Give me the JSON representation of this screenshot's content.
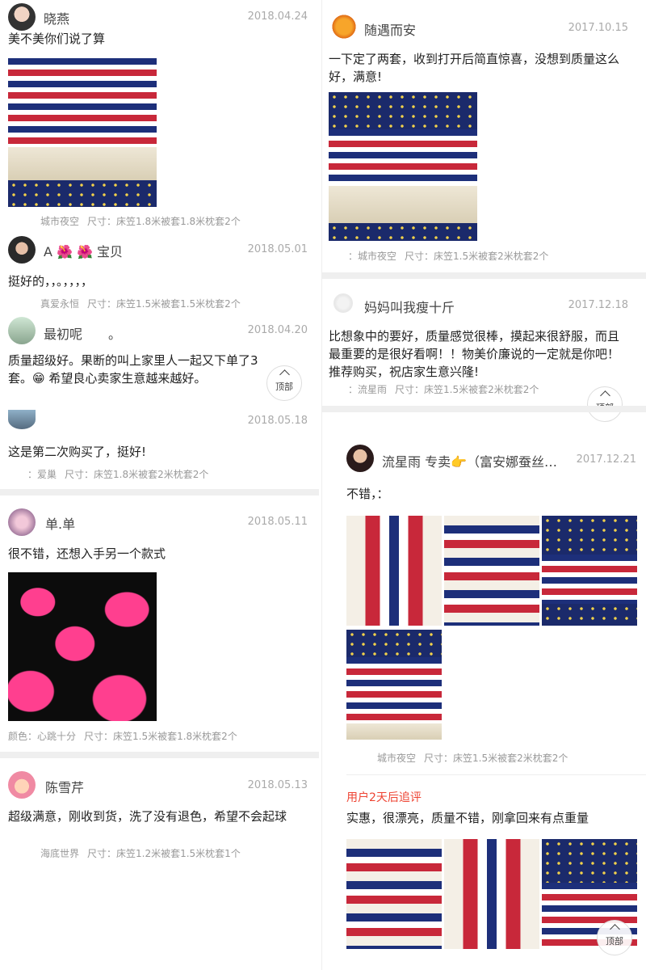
{
  "left_reviews": [
    {
      "user": "晓燕",
      "date": "2018.04.24",
      "text": "美不美你们说了算",
      "meta_a": "城市夜空",
      "meta_b": "尺寸：床笠1.8米被套1.8米枕套2个"
    },
    {
      "user": "A 🌺 🌺 宝贝",
      "date": "2018.05.01",
      "text": "挺好的，，。，，，，",
      "meta_a": "真爱永恒",
      "meta_b": "尺寸：床笠1.5米被套1.5米枕套2个"
    },
    {
      "user": "最初呢　　。",
      "date": "2018.04.20",
      "text": "质量超级好。果断的叫上家里人一起又下单了3套。😁 希望良心卖家生意越来越好。"
    },
    {
      "user": "",
      "date": "2018.05.18",
      "text": "这是第二次购买了，挺好!",
      "meta_a": "：爱巢",
      "meta_b": "尺寸：床笠1.8米被套2米枕套2个"
    },
    {
      "user": "单.单",
      "date": "2018.05.11",
      "text": "很不错，还想入手另一个款式",
      "meta_a": "颜色：心跳十分",
      "meta_b": "尺寸：床笠1.5米被套1.8米枕套2个"
    },
    {
      "user": "陈雪芹",
      "date": "2018.05.13",
      "text": "超级满意，刚收到货，洗了没有退色，希望不会起球",
      "meta_a": "海底世界",
      "meta_b": "尺寸：床笠1.2米被套1.5米枕套1个"
    }
  ],
  "right_reviews": [
    {
      "user": "随遇而安",
      "date": "2017.10.15",
      "text": "一下定了两套，收到打开后简直惊喜，没想到质量这么好，满意!",
      "meta_a": "：城市夜空",
      "meta_b": "尺寸：床笠1.5米被套2米枕套2个"
    },
    {
      "user": "妈妈叫我瘦十斤",
      "date": "2017.12.18",
      "text": "比想象中的要好，质量感觉很棒，摸起来很舒服，而且最重要的是很好看啊！！物美价廉说的一定就是你吧！推荐购买，祝店家生意兴隆!",
      "meta_a": "：流星雨",
      "meta_b": "尺寸：床笠1.5米被套2米枕套2个"
    },
    {
      "user": "流星雨 专卖👉（富安娜蚕丝…",
      "date": "2017.12.21",
      "text": "不错，：",
      "meta_a": "城市夜空",
      "meta_b": "尺寸：床笠1.5米被套2米枕套2个",
      "follow_label": "用户2天后追评",
      "follow_text": "实惠，很漂亮，质量不错，刚拿回来有点重量"
    }
  ],
  "top_button_label": "顶部",
  "icons": [
    "chevron-up-icon"
  ],
  "colors": {
    "accent": "#e43",
    "muted": "#999",
    "separator": "#efefef"
  }
}
